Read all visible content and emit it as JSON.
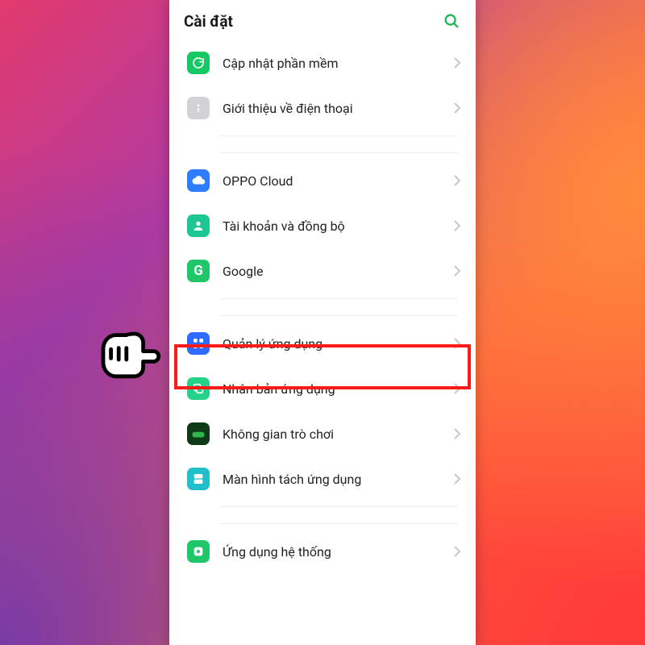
{
  "header": {
    "title": "Cài đặt"
  },
  "rows": {
    "software_update": "Cập nhật phần mềm",
    "about_phone": "Giới thiệu về điện thoại",
    "oppo_cloud": "OPPO Cloud",
    "accounts_sync": "Tài khoản và đồng bộ",
    "google": "Google",
    "app_management": "Quản lý ứng dụng",
    "app_clone": "Nhân bản ứng dụng",
    "game_space": "Không gian trò chơi",
    "split_screen": "Màn hình tách ứng dụng",
    "system_apps": "Ứng dụng hệ thống"
  }
}
